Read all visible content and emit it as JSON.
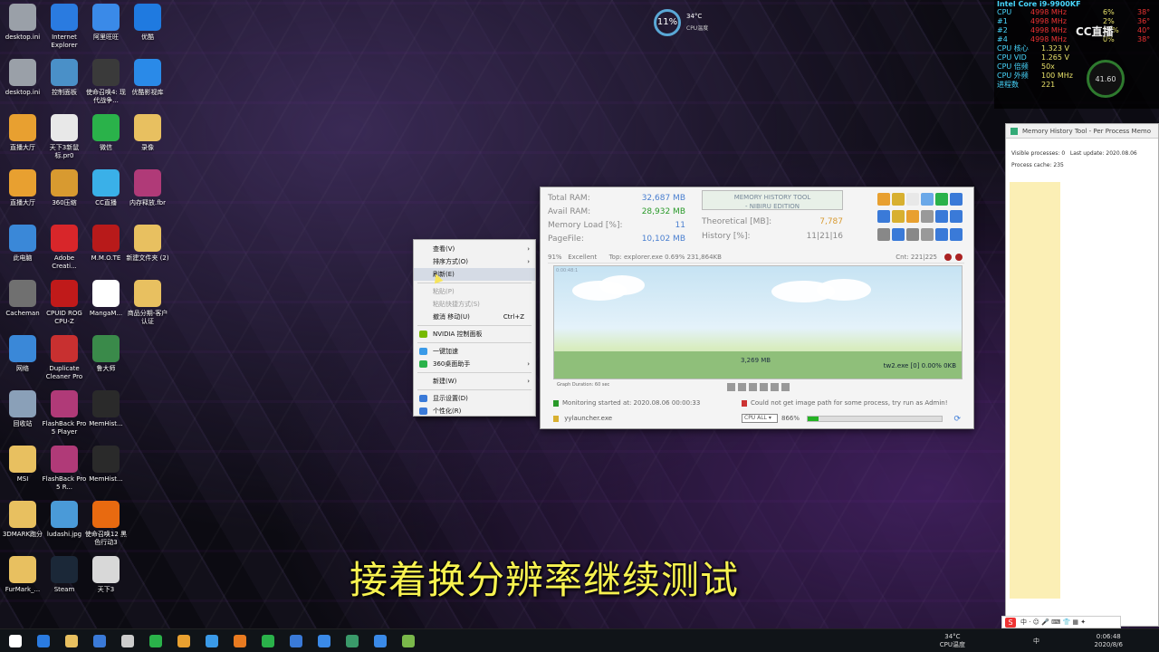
{
  "desktop": {
    "icons": [
      {
        "label": "desktop.ini",
        "icon": "file-icon",
        "color": "#9aa0a8"
      },
      {
        "label": "Internet Explorer",
        "icon": "ie-icon",
        "color": "#2a7be0"
      },
      {
        "label": "阿里旺旺",
        "icon": "wangwang-icon",
        "color": "#3a8ae8"
      },
      {
        "label": "优酷",
        "icon": "youku-play-icon",
        "color": "#1f7ae0"
      },
      {
        "label": "desktop.ini",
        "icon": "file-icon",
        "color": "#9aa0a8"
      },
      {
        "label": "控制面板",
        "icon": "control-panel-icon",
        "color": "#4a90c8"
      },
      {
        "label": "使命召唤4: 现代战争...",
        "icon": "cod-icon",
        "color": "#3a3a3a"
      },
      {
        "label": "优酷影视库",
        "icon": "youku-folder-icon",
        "color": "#2a8ae8"
      },
      {
        "label": "直播大厅",
        "icon": "live-hall-icon",
        "color": "#e8a030"
      },
      {
        "label": "天下3新鼠标.pr0",
        "icon": "file-icon",
        "color": "#e8e8e8"
      },
      {
        "label": "微信",
        "icon": "wechat-icon",
        "color": "#2ab24a"
      },
      {
        "label": "录像",
        "icon": "folder-icon",
        "color": "#e8c060"
      },
      {
        "label": "直播大厅",
        "icon": "live-hall-icon",
        "color": "#e8a030"
      },
      {
        "label": "360压缩",
        "icon": "archive-icon",
        "color": "#d89a30"
      },
      {
        "label": "CC直播",
        "icon": "cc-live-icon",
        "color": "#3ab0e8"
      },
      {
        "label": "内存释放.fbr",
        "icon": "flashback-icon",
        "color": "#b03a78"
      },
      {
        "label": "此电脑",
        "icon": "computer-icon",
        "color": "#3a88d8"
      },
      {
        "label": "Adobe Creati...",
        "icon": "adobe-cc-icon",
        "color": "#d8262a"
      },
      {
        "label": "M.M.O.TE",
        "icon": "mmo-icon",
        "color": "#b81a1a"
      },
      {
        "label": "新建文件夹 (2)",
        "icon": "folder-icon",
        "color": "#e8c060"
      },
      {
        "label": "Cacheman",
        "icon": "ram-chip-icon",
        "color": "#707070"
      },
      {
        "label": "CPUID ROG CPU-Z",
        "icon": "cpuz-icon",
        "color": "#c01a1a"
      },
      {
        "label": "MangaM...",
        "icon": "manga-icon",
        "color": "#ffffff"
      },
      {
        "label": "商品分期-客户认证",
        "icon": "folder-icon",
        "color": "#e8c060"
      },
      {
        "label": "网络",
        "icon": "network-icon",
        "color": "#3a88d8"
      },
      {
        "label": "Duplicate Cleaner Pro",
        "icon": "duplicate-icon",
        "color": "#c83030"
      },
      {
        "label": "鲁大师",
        "icon": "ludashi-icon",
        "color": "#3a8a4a"
      },
      {
        "label": "",
        "icon": "",
        "color": ""
      },
      {
        "label": "回收站",
        "icon": "recycle-bin-icon",
        "color": "#8aa0b8"
      },
      {
        "label": "FlashBack Pro 5 Player",
        "icon": "flashback-icon",
        "color": "#b03a78"
      },
      {
        "label": "MemHist...",
        "icon": "memhist-icon",
        "color": "#2a2a2a"
      },
      {
        "label": "",
        "icon": "",
        "color": ""
      },
      {
        "label": "MSI",
        "icon": "folder-icon",
        "color": "#e8c060"
      },
      {
        "label": "FlashBack Pro 5 R...",
        "icon": "flashback-icon",
        "color": "#b03a78"
      },
      {
        "label": "MemHist...",
        "icon": "memhist-icon",
        "color": "#2a2a2a"
      },
      {
        "label": "",
        "icon": "",
        "color": ""
      },
      {
        "label": "3DMARK跑分",
        "icon": "folder-icon",
        "color": "#e8c060"
      },
      {
        "label": "ludashi.jpg",
        "icon": "image-file-icon",
        "color": "#4a9ad8"
      },
      {
        "label": "使命召唤12 黑色行动3",
        "icon": "cod-icon",
        "color": "#e86a10"
      },
      {
        "label": "",
        "icon": "",
        "color": ""
      },
      {
        "label": "FurMark_...",
        "icon": "folder-icon",
        "color": "#e8c060"
      },
      {
        "label": "Steam",
        "icon": "steam-icon",
        "color": "#1b2838"
      },
      {
        "label": "天下3",
        "icon": "tianxia3-icon",
        "color": "#d8d8d8"
      }
    ]
  },
  "context_menu": {
    "items": [
      {
        "label": "查看(V)",
        "submenu": true
      },
      {
        "label": "排序方式(O)",
        "submenu": true
      },
      {
        "label": "刷新(E)",
        "hover": true
      },
      {
        "sep": true
      },
      {
        "label": "粘贴(P)",
        "disabled": true
      },
      {
        "label": "粘贴快捷方式(S)",
        "disabled": true
      },
      {
        "label": "撤消 移动(U)",
        "shortcut": "Ctrl+Z"
      },
      {
        "sep": true
      },
      {
        "label": "NVIDIA 控制面板",
        "icon_color": "#76b900"
      },
      {
        "sep": true
      },
      {
        "label": "一键加速",
        "icon_color": "#3a9ae8"
      },
      {
        "label": "360桌面助手",
        "icon_color": "#2ab24a",
        "submenu": true
      },
      {
        "sep": true
      },
      {
        "label": "新建(W)",
        "submenu": true
      },
      {
        "sep": true
      },
      {
        "label": "显示设置(D)",
        "icon_color": "#3a7ad8"
      },
      {
        "label": "个性化(R)",
        "icon_color": "#3a7ad8"
      }
    ]
  },
  "mht": {
    "stats": [
      {
        "label": "Total RAM:",
        "value": "32,687 MB",
        "green": false
      },
      {
        "label": "Avail RAM:",
        "value": "28,932 MB",
        "green": true
      },
      {
        "label": "Memory Load [%]:",
        "value": "11",
        "green": false
      },
      {
        "label": "PageFile:",
        "value": "10,102 MB",
        "green": false
      }
    ],
    "logo": {
      "line1": "MEMORY HISTORY TOOL",
      "line2": "- NIBIRU EDITION"
    },
    "theoretical_label": "Theoretical [MB]:",
    "theoretical_value": "7,787",
    "history_label": "History [%]:",
    "history_value": "11|21|16",
    "status": {
      "percent": "91%",
      "quality": "Excellent",
      "top": "Top:  explorer.exe  0.69%  231,864KB",
      "cnt": "Cnt:  221|225"
    },
    "graph": {
      "top_label": "0:00:48:1",
      "mem_label": "3,269 MB",
      "proc_label": "tw2.exe [0]  0.00%  0KB"
    },
    "duration": "Graph Duration: 60 sec",
    "log1": "Monitoring started at: 2020.08.06 00:00:33",
    "log2": "Could not get image path for some process, try run as Admin!",
    "launcher": "yylauncher.exe",
    "cpu_select": "CPU ALL",
    "progress_percent": "866%",
    "progress_fill": 0.08
  },
  "right_panel": {
    "title": "Memory History Tool - Per Process Memo",
    "visible": "Visible processes:",
    "visible_value": "0",
    "last_update": "Last update:",
    "last_update_value": "2020.08.06",
    "cache": "Process cache:",
    "cache_value": "235"
  },
  "cpu_monitor": {
    "title": "Intel Core i9-9900KF",
    "rows": [
      {
        "k": "CPU",
        "m": "4998 MHz",
        "p": "6%",
        "d": "38°"
      },
      {
        "k": "#1",
        "m": "4998 MHz",
        "p": "2%",
        "d": "36°"
      },
      {
        "k": "#2",
        "m": "4998 MHz",
        "p": "17%",
        "d": "40°"
      },
      {
        "k": "#4",
        "m": "4998 MHz",
        "p": "0%",
        "d": "38°"
      }
    ],
    "rows2": [
      {
        "k": "CPU 核心",
        "m": "1.323 V"
      },
      {
        "k": "CPU VID",
        "m": "1.265 V"
      },
      {
        "k": "CPU 倍频",
        "m": "50x"
      },
      {
        "k": "CPU 外频",
        "m": "100 MHz"
      },
      {
        "k": "进程数",
        "m": "221"
      }
    ],
    "gauge": "41.60",
    "cc_logo": "CC直播"
  },
  "cpu_widget": {
    "load": "11%",
    "temp": "34°C",
    "label": "CPU温度"
  },
  "subtitle": "接着换分辨率继续测试",
  "taskbar": {
    "icons": [
      {
        "name": "windows-start-icon",
        "color": "#ffffff"
      },
      {
        "name": "edge-icon",
        "color": "#2a7be0"
      },
      {
        "name": "file-explorer-icon",
        "color": "#e8c060"
      },
      {
        "name": "store-icon",
        "color": "#3a7ad8"
      },
      {
        "name": "tool-icon",
        "color": "#cccccc"
      },
      {
        "name": "browser-360-icon",
        "color": "#2ab24a"
      },
      {
        "name": "folder-icon",
        "color": "#e8a030"
      },
      {
        "name": "media-play-icon",
        "color": "#3a9ae8"
      },
      {
        "name": "search-tool-icon",
        "color": "#e87a20"
      },
      {
        "name": "wechat-icon",
        "color": "#2ab24a"
      },
      {
        "name": "app-blue-icon",
        "color": "#3a7ad8"
      },
      {
        "name": "ludashi-icon",
        "color": "#3a8ae8"
      },
      {
        "name": "terminal-icon",
        "color": "#3a9a6a"
      },
      {
        "name": "flashback-icon",
        "color": "#3a8ae8"
      },
      {
        "name": "memhist-icon",
        "color": "#7ab84a"
      }
    ],
    "tray_temp": "34°C",
    "tray_temp_label": "CPU温度",
    "lang": "中",
    "time": "0:06:48",
    "date": "2020/8/6"
  },
  "ime_bar": "中 · ☺ 🎤 ⌨ 👕 ▦ ✦"
}
